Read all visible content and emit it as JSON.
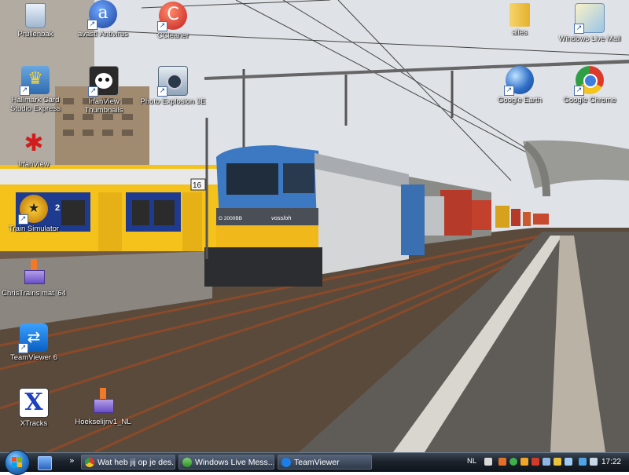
{
  "desktop": {
    "icons": [
      {
        "label": "Prullenbak",
        "icon": "recycle-bin-icon"
      },
      {
        "label": "avast! Antivirus",
        "icon": "avast-icon"
      },
      {
        "label": "CCleaner",
        "icon": "ccleaner-icon"
      },
      {
        "label": "alles",
        "icon": "folder-icon"
      },
      {
        "label": "Windows Live Mail",
        "icon": "windows-live-mail-icon"
      },
      {
        "label": "Hallmark Card Studio Express",
        "icon": "hallmark-crown-icon"
      },
      {
        "label": "IrfanView Thumbnails",
        "icon": "panda-icon"
      },
      {
        "label": "Photo Explosion 3E",
        "icon": "camera-icon"
      },
      {
        "label": "Google Earth",
        "icon": "google-earth-icon"
      },
      {
        "label": "Google Chrome",
        "icon": "chrome-icon"
      },
      {
        "label": "IrfanView",
        "icon": "irfanview-cat-icon"
      },
      {
        "label": "Train Simulator",
        "icon": "train-simulator-icon"
      },
      {
        "label": "ChrisTrains mat '64",
        "icon": "installer-box-icon"
      },
      {
        "label": "TeamViewer 6",
        "icon": "teamviewer-icon"
      },
      {
        "label": "XTracks",
        "icon": "xtracks-icon"
      },
      {
        "label": "Hoekselijnv1_NL",
        "icon": "installer-box-icon"
      }
    ]
  },
  "taskbar": {
    "buttons": [
      {
        "label": "Wat heb jij op je des...",
        "icon": "chrome-icon"
      },
      {
        "label": "Windows Live Mess...",
        "icon": "messenger-icon"
      },
      {
        "label": "TeamViewer",
        "icon": "teamviewer-icon"
      }
    ],
    "language": "NL",
    "clock": "17:22"
  },
  "wallpaper": {
    "signs": {
      "platform": "16",
      "train_unit": "2",
      "loco_number": "G 2000BB",
      "loco_brand": "vossloh"
    }
  },
  "colors": {
    "sky": "#d9dde3",
    "taskbar": "#1c232c",
    "label_text": "#ffffff",
    "ns_yellow": "#f4c21b",
    "ns_blue": "#1e3b8f"
  }
}
